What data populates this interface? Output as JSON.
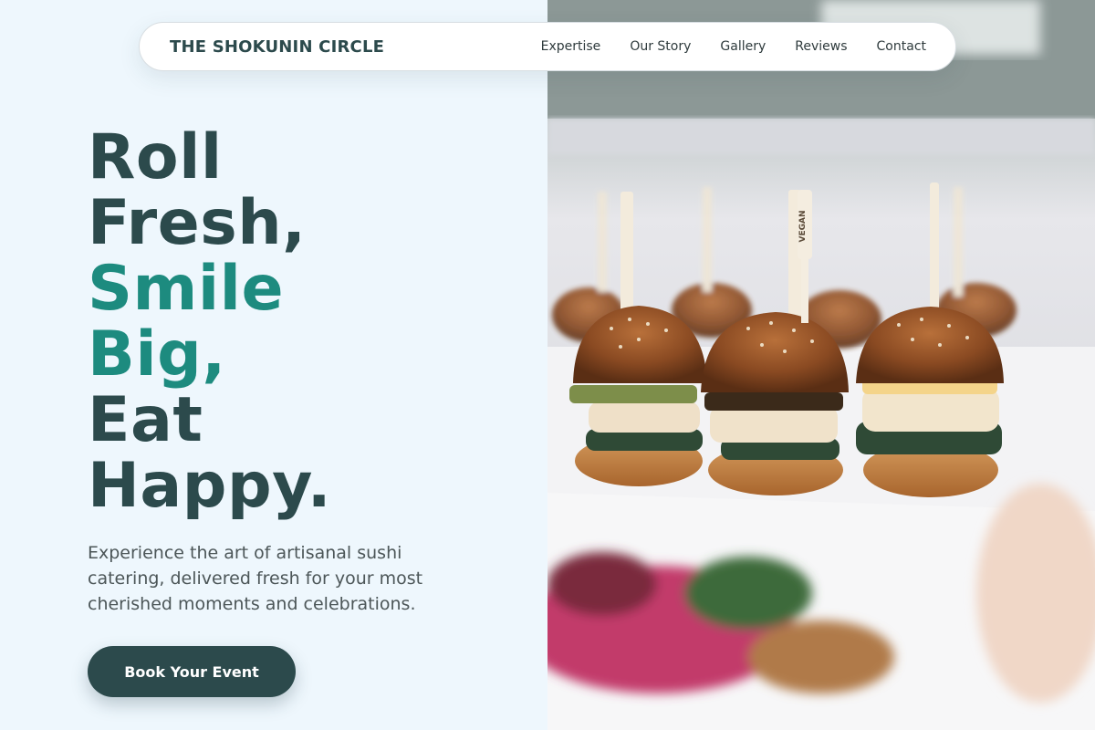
{
  "nav": {
    "brand": "THE SHOKUNIN CIRCLE",
    "links": [
      "Expertise",
      "Our Story",
      "Gallery",
      "Reviews",
      "Contact"
    ]
  },
  "hero": {
    "headline_lines": [
      "Roll",
      "Fresh,",
      "Smile",
      "Big,",
      "Eat",
      "Happy."
    ],
    "accent_lines": [
      2,
      3
    ],
    "subtitle": "Experience the art of artisanal sushi catering, delivered fresh for your most cherished moments and celebrations.",
    "cta_label": "Book Your Event",
    "image_pick_label": "VEGAN"
  },
  "colors": {
    "primary": "#2c4a4c",
    "accent": "#1d8b7f",
    "background": "#eef7fd"
  }
}
